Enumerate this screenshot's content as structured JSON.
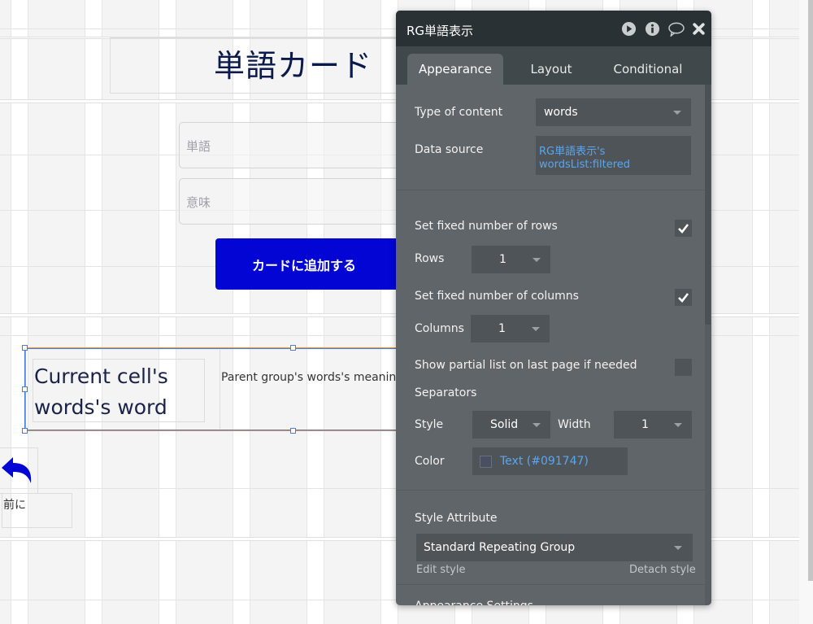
{
  "canvas": {
    "page_title": "単語カード",
    "word_input_placeholder": "単語",
    "meaning_input_placeholder": "意味",
    "add_button_label": "カードに追加する",
    "repeating_group": {
      "cell_word_text": "Current cell's words's word",
      "cell_meaning_text": "Parent group's words's meaning"
    },
    "back_label": "前に",
    "colors": {
      "button": "#0205d3",
      "back_icon": "#0205d3",
      "selection_border": "#e9903d"
    }
  },
  "panel": {
    "title": "RG単語表示",
    "header_icons": [
      "play-icon",
      "info-icon",
      "comment-icon",
      "close-icon"
    ],
    "tabs": [
      {
        "label": "Appearance",
        "active": true
      },
      {
        "label": "Layout",
        "active": false
      },
      {
        "label": "Conditional",
        "active": false
      }
    ],
    "type_of_content": {
      "label": "Type of content",
      "value": "words"
    },
    "data_source": {
      "label": "Data source",
      "value_line1": "RG単語表示's",
      "value_line2": "wordsList:filtered"
    },
    "fixed_rows": {
      "label": "Set fixed number of rows",
      "checked": true
    },
    "rows": {
      "label": "Rows",
      "value": "1"
    },
    "fixed_columns": {
      "label": "Set fixed number of columns",
      "checked": true
    },
    "columns": {
      "label": "Columns",
      "value": "1"
    },
    "partial_list": {
      "label": "Show partial list on last page if needed",
      "checked": false
    },
    "separators": {
      "label": "Separators",
      "style_label": "Style",
      "style_value": "Solid",
      "width_label": "Width",
      "width_value": "1",
      "color_label": "Color",
      "color_value": "Text (#091747)",
      "color_swatch": "#091747"
    },
    "style_attribute": {
      "label": "Style Attribute",
      "value": "Standard Repeating Group",
      "edit_style": "Edit style",
      "detach_style": "Detach style"
    },
    "next_section_partial": "Appearance Settings"
  }
}
